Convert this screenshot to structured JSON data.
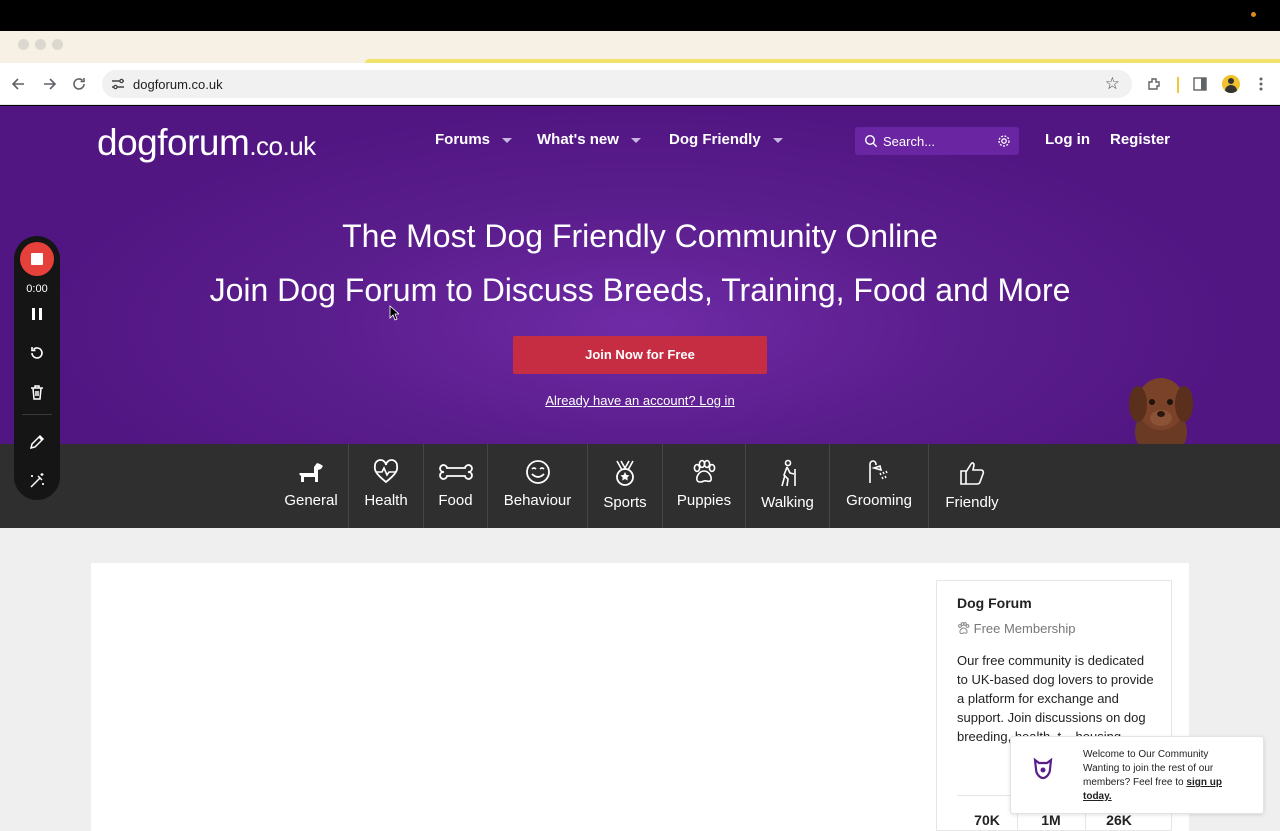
{
  "browser": {
    "url": "dogforum.co.uk"
  },
  "site": {
    "logo_main": "dogforum",
    "logo_tld": ".co.uk",
    "nav": [
      {
        "label": "Forums"
      },
      {
        "label": "What's new"
      },
      {
        "label": "Dog Friendly"
      }
    ],
    "search_placeholder": "Search...",
    "login": "Log in",
    "register": "Register",
    "colors": {
      "hero": "#5a1d8c",
      "cta": "#c62d42",
      "category_bar": "#2f2f2f"
    }
  },
  "hero": {
    "title": "The Most Dog Friendly Community Online",
    "subtitle": "Join Dog Forum to Discuss Breeds, Training, Food and More",
    "cta": "Join Now for Free",
    "login_link": "Already have an account? Log in"
  },
  "categories": [
    {
      "label": "General",
      "icon": "dog-icon"
    },
    {
      "label": "Health",
      "icon": "heart-pulse-icon"
    },
    {
      "label": "Food",
      "icon": "bone-icon"
    },
    {
      "label": "Behaviour",
      "icon": "smile-icon"
    },
    {
      "label": "Sports",
      "icon": "medal-icon"
    },
    {
      "label": "Puppies",
      "icon": "paw-icon"
    },
    {
      "label": "Walking",
      "icon": "hiker-icon"
    },
    {
      "label": "Grooming",
      "icon": "shower-icon"
    },
    {
      "label": "Friendly",
      "icon": "thumbs-up-icon"
    }
  ],
  "sidebar": {
    "title": "Dog Forum",
    "subtitle": "Free Membership",
    "body": "Our free community is dedicated to UK-based dog lovers to provide a platform for exchange and support. Join discussions on dog breeding, health, t... housing",
    "stats": [
      "70K",
      "1M",
      "26K"
    ]
  },
  "toast": {
    "line1": "Welcome to Our Community",
    "line2": "Wanting to join the rest of our members? Feel free to",
    "link": "sign up today."
  },
  "recorder": {
    "time": "0:00"
  }
}
